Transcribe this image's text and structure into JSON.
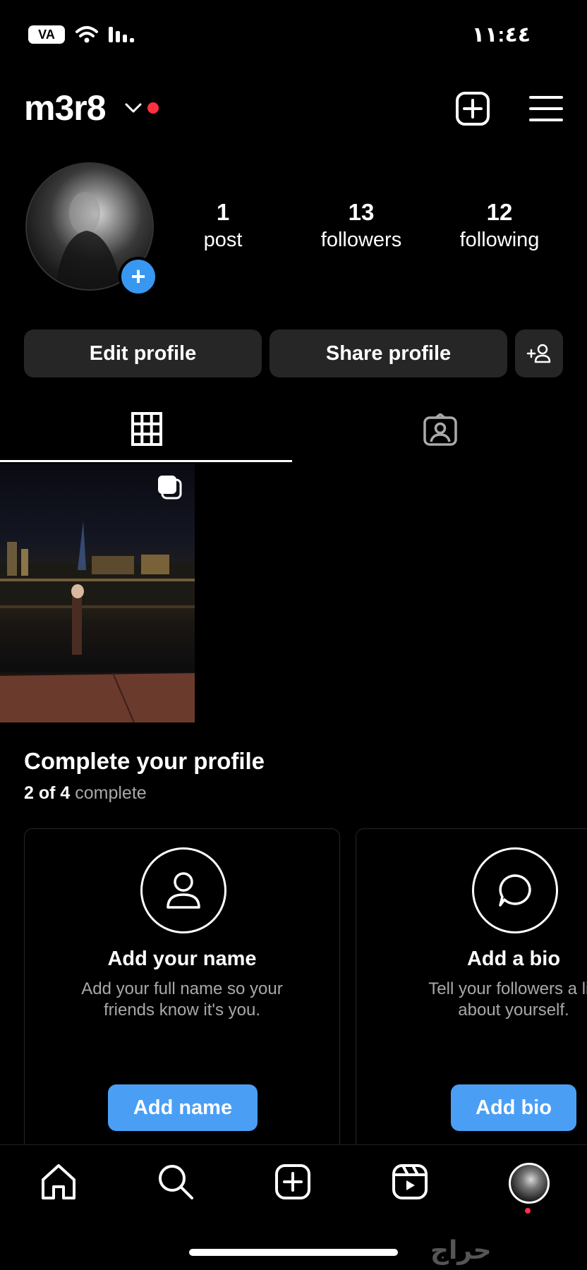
{
  "status_bar": {
    "time": "١١:٤٤",
    "battery": "VA"
  },
  "header": {
    "username": "m3r8"
  },
  "stats": [
    {
      "value": "1",
      "label": "post"
    },
    {
      "value": "13",
      "label": "followers"
    },
    {
      "value": "12",
      "label": "following"
    }
  ],
  "buttons": {
    "edit": "Edit profile",
    "share": "Share profile"
  },
  "complete_profile": {
    "title": "Complete your profile",
    "progress_count": "2 of 4",
    "progress_word": "complete",
    "cards": [
      {
        "title": "Add your name",
        "description": "Add your full name so your\nfriends know it's you.",
        "button": "Add name",
        "icon": "person-icon"
      },
      {
        "title": "Add a bio",
        "description": "Tell your followers a litt\nabout yourself.",
        "button": "Add bio",
        "icon": "speech-bubble-icon"
      }
    ]
  },
  "watermark": "حراج",
  "colors": {
    "accent": "#4a9ff5",
    "notification": "#ff3040",
    "button_bg": "#262626"
  }
}
